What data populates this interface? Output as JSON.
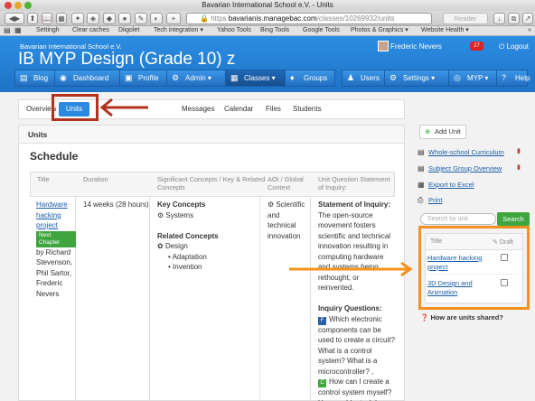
{
  "browser": {
    "title": "Bavarian International School e.V. - Units",
    "url_host": "bavarianis.managebac.com",
    "url_path": "/classes/10269932/units",
    "protocol": "https",
    "reader": "Reader"
  },
  "bookmarks": [
    "Settingh",
    "Clear caches",
    "Diigolet",
    "Tech integration ▾",
    "Yahoo Tools",
    "Bing Tools",
    "Google Tools",
    "Photos & Graphics ▾",
    "Website Health ▾"
  ],
  "header": {
    "school": "Bavarian International School e.V.",
    "program": "IB MYP Design (Grade 10) z",
    "user": "Frederic Nevers",
    "notifications": "27",
    "logout": "Logout"
  },
  "nav": [
    {
      "label": "Blog",
      "icon": "▤"
    },
    {
      "label": "Dashboard",
      "icon": "◉"
    },
    {
      "label": "Profile",
      "icon": "▣"
    },
    {
      "label": "Admin ▾",
      "icon": "⚙"
    },
    {
      "label": "Classes ▾",
      "icon": "▦"
    },
    {
      "label": "Groups",
      "icon": "♦"
    },
    {
      "label": "Users",
      "icon": "♟"
    },
    {
      "label": "Settings ▾",
      "icon": "⚙"
    },
    {
      "label": "MYP ▾",
      "icon": "◎"
    },
    {
      "label": "Help",
      "icon": "?"
    }
  ],
  "tabs": [
    "Overview",
    "Units",
    "Messages",
    "Calendar",
    "Files",
    "Students"
  ],
  "panel": {
    "title": "Units",
    "schedule": "Schedule"
  },
  "table_headers": [
    "Title",
    "Duration",
    "Significant Concepts / Key & Related Concepts",
    "AOI / Global Context",
    "Unit Question Statement of Inquiry:"
  ],
  "unit": {
    "title": "Hardware hacking project",
    "badge": "Next Chapter",
    "authors": "by Richard Stevenson, Phil Sartor, Frederic Nevers",
    "duration": "14 weeks (28 hours)",
    "key_concepts_label": "Key Concepts",
    "key_concept": "Systems",
    "related_concepts_label": "Related Concepts",
    "related_concept": "Design",
    "related_items": [
      "Adaptation",
      "Invention"
    ],
    "aoi": "Scientific and technical innovation",
    "soi_label": "Statement of Inquiry:",
    "soi": "The open-source movement fosters scientific and technical innovation resulting in computing hardware and systems being rethought, or reinvented.",
    "iq_label": "Inquiry Questions:",
    "q1_badge": "F",
    "q1": "Which electronic components can be used to create a circuit? What is a control system? What is a microcontroller? ,",
    "q2_badge": "C",
    "q2": "How can I create a control system myself? How could a task be"
  },
  "sidebar": {
    "add_unit": "Add Unit",
    "links": [
      "Whole-school Curriculum",
      "Subject Group Overview",
      "Export to Excel",
      "Print"
    ],
    "search_placeholder": "Search by unit",
    "search_button": "Search",
    "table_title": "Title",
    "table_draft": "Draft",
    "units": [
      "Hardware hacking project",
      "3D Design and Animation"
    ],
    "help": "How are units shared?"
  },
  "colors": {
    "accent": "#2b89e0",
    "annotation_red": "#b5311f",
    "annotation_orange": "#f7901e",
    "green": "#3fa53f"
  }
}
